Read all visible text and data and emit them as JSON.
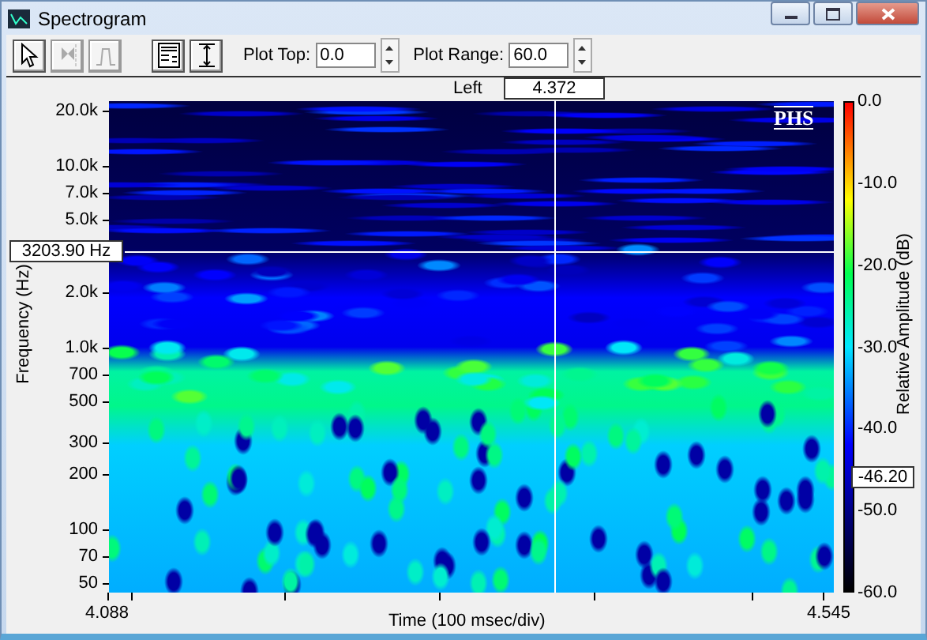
{
  "window": {
    "title": "Spectrogram"
  },
  "toolbar": {
    "tools": [
      {
        "kind": "pointer",
        "disabled": false
      },
      {
        "kind": "marker",
        "disabled": true
      },
      {
        "kind": "peak",
        "disabled": true
      },
      {
        "kind": "panel",
        "disabled": false
      },
      {
        "kind": "range",
        "disabled": false
      }
    ],
    "fields": [
      {
        "label": "Plot Top:",
        "value": "0.0"
      },
      {
        "label": "Plot Range:",
        "value": "60.0"
      }
    ]
  },
  "plot": {
    "cursor_label": "Left",
    "cursor_time": "4.372",
    "cursor_frequency": "3203.90 Hz",
    "logo": "PHS",
    "y_axis": {
      "title": "Frequency (Hz)",
      "ticks": [
        "20.0k",
        "10.0k",
        "7.0k",
        "5.0k",
        "2.0k",
        "1.0k",
        "700",
        "500",
        "300",
        "200",
        "100",
        "70",
        "50"
      ]
    },
    "x_axis": {
      "title": "Time (100 msec/div)",
      "start": "4.088",
      "end": "4.545"
    },
    "color_scale": {
      "title": "Relative Amplitude (dB)",
      "ticks": [
        "0.0",
        "-10.0",
        "-20.0",
        "-30.0",
        "-40.0",
        "-50.0",
        "-60.0"
      ],
      "cursor_value": "-46.20"
    }
  }
}
